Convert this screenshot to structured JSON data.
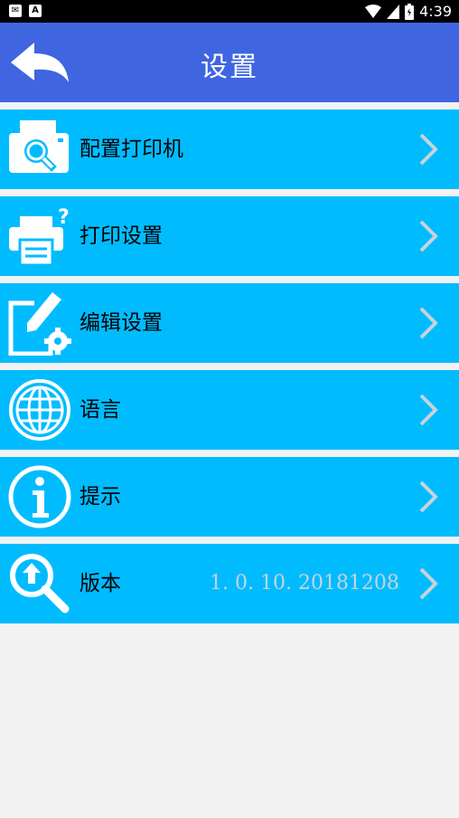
{
  "status_bar": {
    "time": "4:39",
    "left_icons": [
      "email-notification-icon",
      "a-notification-icon"
    ],
    "right_icons": [
      "wifi-icon",
      "signal-icon",
      "battery-icon"
    ]
  },
  "header": {
    "title": "设置",
    "back_icon": "back-arrow-icon",
    "background": "#3f65e0"
  },
  "menu": {
    "accent": "#00bcff",
    "items": [
      {
        "label": "配置打印机",
        "icon": "printer-search-icon"
      },
      {
        "label": "打印设置",
        "icon": "printer-question-icon"
      },
      {
        "label": "编辑设置",
        "icon": "edit-gear-icon"
      },
      {
        "label": "语言",
        "icon": "globe-icon"
      },
      {
        "label": "提示",
        "icon": "info-icon"
      },
      {
        "label": "版本",
        "icon": "update-search-icon",
        "value": "1. 0. 10. 20181208"
      }
    ]
  }
}
